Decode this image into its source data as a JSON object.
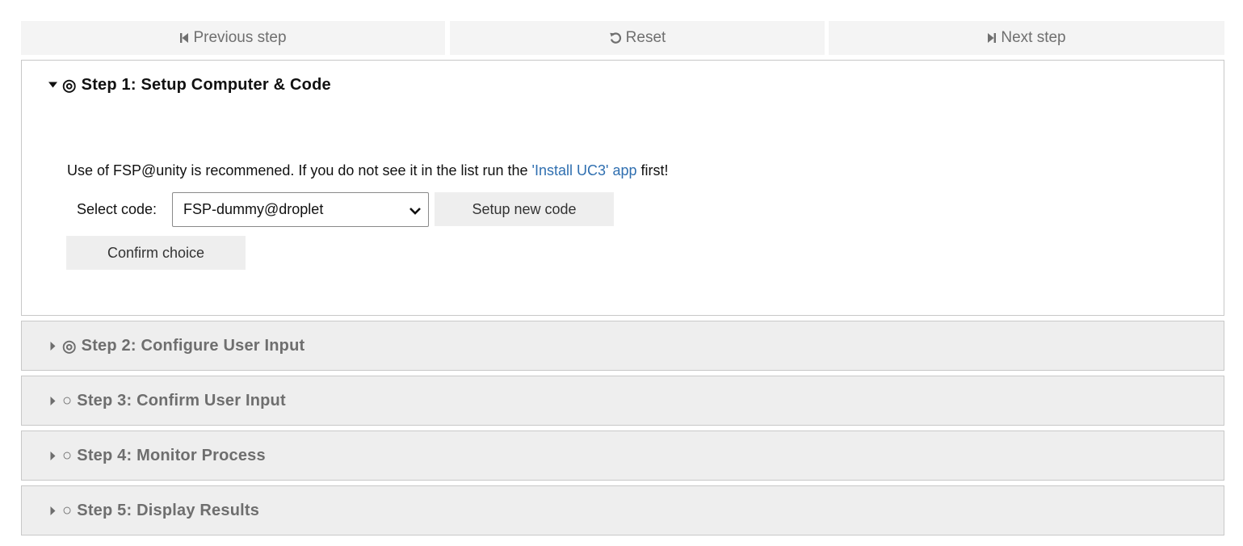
{
  "nav": {
    "previous_label": "Previous step",
    "reset_label": "Reset",
    "next_label": "Next step"
  },
  "steps": [
    {
      "title": "Step 1: Setup Computer & Code",
      "expanded": true,
      "marker": "◎",
      "intro_text": "Use of FSP@unity is recommened. If you do not see it in the list run the ",
      "intro_link": "'Install UC3' app",
      "intro_after": " first!",
      "select_label": "Select code:",
      "select_value": "FSP-dummy@droplet",
      "setup_new_code_label": "Setup new code",
      "confirm_label": "Confirm choice"
    },
    {
      "title": "Step 2: Configure User Input",
      "expanded": false,
      "marker": "◎"
    },
    {
      "title": "Step 3: Confirm User Input",
      "expanded": false,
      "marker": "○"
    },
    {
      "title": "Step 4: Monitor Process",
      "expanded": false,
      "marker": "○"
    },
    {
      "title": "Step 5: Display Results",
      "expanded": false,
      "marker": "○"
    }
  ],
  "colors": {
    "link": "#2f6fb0",
    "nav_bg": "#f4f4f4",
    "closed_step_bg": "#eeeeee"
  },
  "icons": {
    "previous": "step-backward-icon",
    "reset": "undo-icon",
    "next": "step-forward-icon",
    "expanded": "caret-down-icon",
    "collapsed": "caret-right-icon"
  }
}
